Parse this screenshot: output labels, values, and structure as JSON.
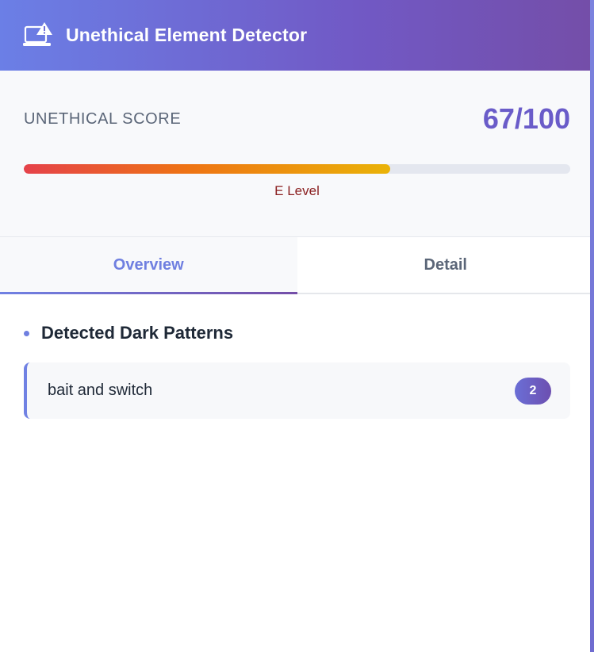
{
  "header": {
    "title": "Unethical Element Detector",
    "icon": "laptop-warning-icon"
  },
  "score": {
    "label": "UNETHICAL SCORE",
    "value_text": "67/100",
    "value": 67,
    "max": 100,
    "level": "E Level"
  },
  "tabs": [
    {
      "label": "Overview",
      "active": true
    },
    {
      "label": "Detail",
      "active": false
    }
  ],
  "patterns": {
    "heading": "Detected Dark Patterns",
    "items": [
      {
        "name": "bait and switch",
        "count": "2"
      }
    ]
  },
  "colors": {
    "accent": "#6f7fe0",
    "header_start": "#6b7fe6",
    "header_end": "#744ea8",
    "score_value": "#6a5cc9",
    "level_text": "#8a1f1f"
  }
}
